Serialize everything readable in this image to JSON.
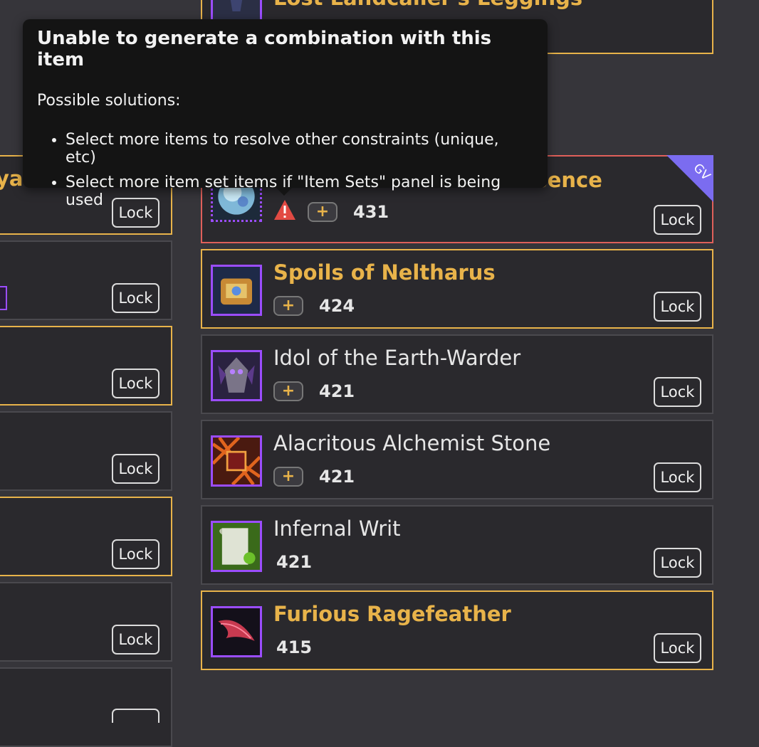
{
  "lock_label": "Lock",
  "top_card": {
    "name": "Lost Landcaller's Leggings"
  },
  "left_partial_title": "yalties",
  "left_cards": [
    {},
    {},
    {},
    {},
    {},
    {}
  ],
  "tooltip": {
    "title": "Unable to generate a combination with this item",
    "subtitle": "Possible solutions:",
    "solutions": [
      "Select more items to resolve other constraints (unique, etc)",
      "Select more item set items if \"Item Sets\" panel is being used"
    ]
  },
  "error_card": {
    "name": "Ominous Chromatic Essence",
    "ilvl": "431",
    "badge": "GV",
    "warning_icon": "warning-triangle-icon"
  },
  "items": [
    {
      "name": "Spoils of Neltharus",
      "ilvl": "424",
      "quality": "legendary",
      "has_plus": true
    },
    {
      "name": "Idol of the Earth-Warder",
      "ilvl": "421",
      "quality": "normal",
      "has_plus": true
    },
    {
      "name": "Alacritous Alchemist Stone",
      "ilvl": "421",
      "quality": "normal",
      "has_plus": true
    },
    {
      "name": "Infernal Writ",
      "ilvl": "421",
      "quality": "normal",
      "has_plus": false
    },
    {
      "name": "Furious Ragefeather",
      "ilvl": "415",
      "quality": "legendary",
      "has_plus": false
    }
  ],
  "colors": {
    "legendary": "#e8b34a",
    "error_border": "#e0605a",
    "epic_icon_border": "#9b4dff",
    "gv_badge": "#7b6cf0",
    "background": "#36353a",
    "card": "#2a292d"
  }
}
